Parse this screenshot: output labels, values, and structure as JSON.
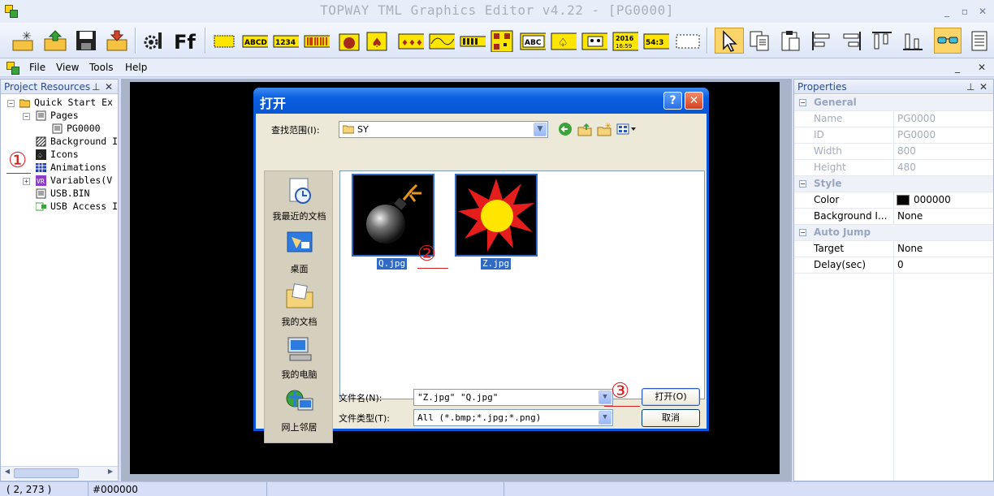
{
  "window": {
    "title": "TOPWAY TML Graphics Editor v4.22 - [PG0000]",
    "min": "_",
    "restore": "▫",
    "close": "✕"
  },
  "toolbar": {
    "buttons": [
      "new-project-icon",
      "open-project-icon",
      "save-icon",
      "import-icon",
      "settings-icon",
      "font-icon",
      "rectangle-icon",
      "text-abcd-icon",
      "number-1234-icon",
      "barcode-icon",
      "bomb-icon",
      "spade-icon",
      "gauge-icon",
      "wave-icon",
      "progress-icon",
      "qrcode-icon",
      "abc-button-icon",
      "icon-button-icon",
      "robot-icon",
      "date-icon",
      "time-icon",
      "frame-icon",
      "select-arrow-icon",
      "copy-icon",
      "paste-icon",
      "align-left-icon",
      "align-right-icon",
      "align-top-icon",
      "align-bottom-icon",
      "preview-glasses-icon",
      "notes-icon"
    ]
  },
  "menu": {
    "items": [
      "File",
      "View",
      "Tools",
      "Help"
    ],
    "pin": "_",
    "close": "✕"
  },
  "left_panel": {
    "title": "Project Resources",
    "tree": [
      {
        "label": "Quick Start Ex",
        "icon": "folder-icon"
      },
      {
        "label": "Pages",
        "icon": "pages-icon"
      },
      {
        "label": "PG0000",
        "icon": "page-icon"
      },
      {
        "label": "Background I",
        "icon": "background-icon"
      },
      {
        "label": "Icons",
        "icon": "icons-icon"
      },
      {
        "label": "Animations",
        "icon": "animations-icon"
      },
      {
        "label": "Variables(V",
        "icon": "variables-icon"
      },
      {
        "label": "USB.BIN",
        "icon": "bin-icon"
      },
      {
        "label": "USB Access I",
        "icon": "usb-icon"
      }
    ]
  },
  "annotations": {
    "one": "①",
    "two": "②",
    "three": "③"
  },
  "dialog": {
    "title": "打开",
    "lookin_label": "查找范围(I):",
    "lookin_value": "SY",
    "places": [
      "我最近的文档",
      "桌面",
      "我的文档",
      "我的电脑",
      "网上邻居"
    ],
    "files": [
      {
        "name": "Q.jpg"
      },
      {
        "name": "Z.jpg"
      }
    ],
    "filename_label": "文件名(N):",
    "filename_value": "\"Z.jpg\" \"Q.jpg\"",
    "filetype_label": "文件类型(T):",
    "filetype_value": "All (*.bmp;*.jpg;*.png)",
    "open_button": "打开(O)",
    "cancel_button": "取消"
  },
  "properties": {
    "title": "Properties",
    "categories": [
      {
        "name": "General",
        "rows": [
          {
            "k": "Name",
            "v": "PG0000"
          },
          {
            "k": "ID",
            "v": "PG0000"
          },
          {
            "k": "Width",
            "v": "800"
          },
          {
            "k": "Height",
            "v": "480"
          }
        ]
      },
      {
        "name": "Style",
        "rows": [
          {
            "k": "Color",
            "v": "000000"
          },
          {
            "k": "Background I...",
            "v": "None"
          }
        ]
      },
      {
        "name": "Auto Jump",
        "rows": [
          {
            "k": "Target",
            "v": "None"
          },
          {
            "k": "Delay(sec)",
            "v": "0"
          }
        ]
      }
    ],
    "color_swatch": "#000000"
  },
  "status": {
    "coords": "( 2, 273 )",
    "color": "#000000"
  }
}
